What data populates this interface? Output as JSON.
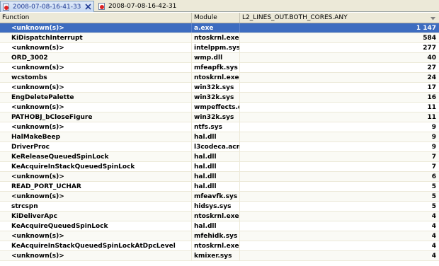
{
  "tabs": [
    {
      "label": "2008-07-08-16-41-33",
      "active": true
    },
    {
      "label": "2008-07-08-16-42-31",
      "active": false
    }
  ],
  "columns": {
    "function": "Function",
    "module": "Module",
    "event": "L2_LINES_OUT.BOTH_CORES.ANY"
  },
  "rows": [
    {
      "function": "<unknown(s)>",
      "module": "a.exe",
      "count": "1 147"
    },
    {
      "function": "KiDispatchInterrupt",
      "module": "ntoskrnl.exe",
      "count": "584"
    },
    {
      "function": "<unknown(s)>",
      "module": "intelppm.sys",
      "count": "277"
    },
    {
      "function": "ORD_3002",
      "module": "wmp.dll",
      "count": "40"
    },
    {
      "function": "<unknown(s)>",
      "module": "mfeapfk.sys",
      "count": "27"
    },
    {
      "function": "wcstombs",
      "module": "ntoskrnl.exe",
      "count": "24"
    },
    {
      "function": "<unknown(s)>",
      "module": "win32k.sys",
      "count": "17"
    },
    {
      "function": "EngDeletePalette",
      "module": "win32k.sys",
      "count": "16"
    },
    {
      "function": "<unknown(s)>",
      "module": "wmpeffects.dll",
      "count": "11"
    },
    {
      "function": "PATHOBJ_bCloseFigure",
      "module": "win32k.sys",
      "count": "11"
    },
    {
      "function": "<unknown(s)>",
      "module": "ntfs.sys",
      "count": "9"
    },
    {
      "function": "HalMakeBeep",
      "module": "hal.dll",
      "count": "9"
    },
    {
      "function": "DriverProc",
      "module": "l3codeca.acm",
      "count": "9"
    },
    {
      "function": "KeReleaseQueuedSpinLock",
      "module": "hal.dll",
      "count": "7"
    },
    {
      "function": "KeAcquireInStackQueuedSpinLock",
      "module": "hal.dll",
      "count": "7"
    },
    {
      "function": "<unknown(s)>",
      "module": "hal.dll",
      "count": "6"
    },
    {
      "function": "READ_PORT_UCHAR",
      "module": "hal.dll",
      "count": "5"
    },
    {
      "function": "<unknown(s)>",
      "module": "mfeavfk.sys",
      "count": "5"
    },
    {
      "function": "strcspn",
      "module": "hidsys.sys",
      "count": "5"
    },
    {
      "function": "KiDeliverApc",
      "module": "ntoskrnl.exe",
      "count": "4"
    },
    {
      "function": "KeAcquireQueuedSpinLock",
      "module": "hal.dll",
      "count": "4"
    },
    {
      "function": "<unknown(s)>",
      "module": "mfehidk.sys",
      "count": "4"
    },
    {
      "function": "KeAcquireInStackQueuedSpinLockAtDpcLevel",
      "module": "ntoskrnl.exe",
      "count": "4"
    },
    {
      "function": "<unknown(s)>",
      "module": "kmixer.sys",
      "count": "4"
    }
  ],
  "icons": {
    "tab": "result-file-icon",
    "close": "close-icon",
    "sort": "sort-descending-icon"
  },
  "colors": {
    "selection": "#3d6cc0",
    "header": "#ece9d8"
  }
}
